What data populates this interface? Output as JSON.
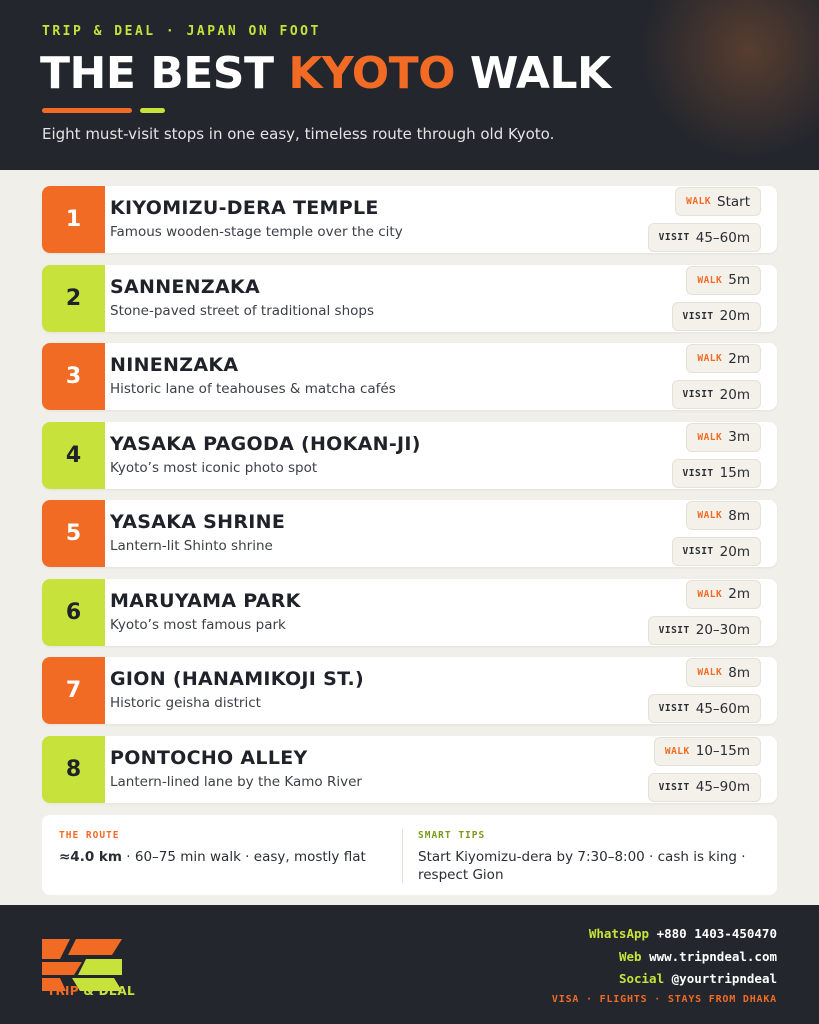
{
  "colors": {
    "orange": "#f26b25",
    "lime": "#c7e23a",
    "dark": "#23262d",
    "cream": "#f1efe9"
  },
  "header": {
    "kicker": "TRIP & DEAL · JAPAN ON FOOT",
    "title_pre": "THE BEST ",
    "title_accent": "KYOTO",
    "title_post": " WALK",
    "subtitle": "Eight must-visit stops in one easy, timeless route through old Kyoto."
  },
  "labels": {
    "walk": "WALK",
    "visit": "VISIT"
  },
  "stops": [
    {
      "number": "1",
      "name": "KIYOMIZU-DERA TEMPLE",
      "desc": "Famous wooden-stage temple over the city",
      "walk": "Start",
      "visit": "45–60m",
      "color": "orange"
    },
    {
      "number": "2",
      "name": "SANNENZAKA",
      "desc": "Stone-paved street of traditional shops",
      "walk": "5m",
      "visit": "20m",
      "color": "lime"
    },
    {
      "number": "3",
      "name": "NINENZAKA",
      "desc": "Historic lane of teahouses & matcha cafés",
      "walk": "2m",
      "visit": "20m",
      "color": "orange"
    },
    {
      "number": "4",
      "name": "YASAKA PAGODA (HOKAN-JI)",
      "desc": "Kyoto’s most iconic photo spot",
      "walk": "3m",
      "visit": "15m",
      "color": "lime"
    },
    {
      "number": "5",
      "name": "YASAKA SHRINE",
      "desc": "Lantern-lit Shinto shrine",
      "walk": "8m",
      "visit": "20m",
      "color": "orange"
    },
    {
      "number": "6",
      "name": "MARUYAMA PARK",
      "desc": "Kyoto’s most famous park",
      "walk": "2m",
      "visit": "20–30m",
      "color": "lime"
    },
    {
      "number": "7",
      "name": "GION (HANAMIKOJI ST.)",
      "desc": "Historic geisha district",
      "walk": "8m",
      "visit": "45–60m",
      "color": "orange"
    },
    {
      "number": "8",
      "name": "PONTOCHO ALLEY",
      "desc": "Lantern-lined lane by the Kamo River",
      "walk": "10–15m",
      "visit": "45–90m",
      "color": "lime"
    }
  ],
  "info": {
    "route_label": "THE ROUTE",
    "route_distance": "≈4.0 km",
    "route_rest": " · 60–75 min walk · easy, mostly flat",
    "tips_label": "SMART TIPS",
    "tips_text": "Start Kiyomizu-dera by 7:30–8:00 · cash is king · respect Gion"
  },
  "footer": {
    "logo_word_a": "TRIP",
    "logo_word_b": " & DEAL",
    "whatsapp_label": "WhatsApp",
    "whatsapp_value": "+880 1403-450470",
    "web_label": "Web",
    "web_value": "www.tripndeal.com",
    "social_label": "Social",
    "social_value": "@yourtripndeal",
    "tagline": "VISA · FLIGHTS · STAYS FROM DHAKA"
  }
}
